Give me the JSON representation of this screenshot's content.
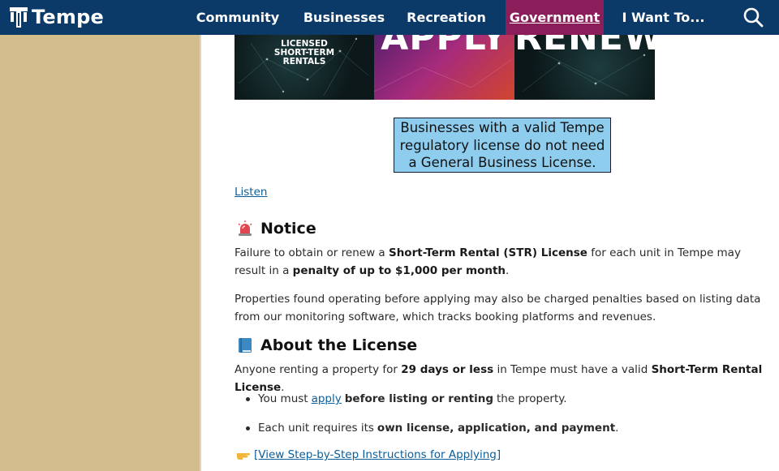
{
  "header": {
    "logo_text": "Tempe",
    "nav": [
      {
        "label": "Community"
      },
      {
        "label": "Businesses"
      },
      {
        "label": "Recreation"
      },
      {
        "label": "Government",
        "active": true
      },
      {
        "label": "I Want To..."
      }
    ],
    "search_icon": "search-icon",
    "colors": {
      "bar": "#0b3a68",
      "active_tab": "#8b1d5a"
    }
  },
  "sidebar": {
    "color": "#d4bd8c"
  },
  "hero": {
    "panel_1_text": "LICENSED\nSHORT-TERM\nRENTALS",
    "panel_2_text": "APPLY",
    "panel_3_text": "RENEW"
  },
  "callout": {
    "text": "Businesses with a valid Tempe regulatory license do not need a General Business License.",
    "color": "#8ecdee"
  },
  "listen_link": "Listen",
  "notice": {
    "icon": "rotating-light-icon",
    "title": "Notice",
    "p1": {
      "t1": "Failure to obtain or renew a ",
      "b1": "Short-Term Rental (STR) License",
      "t2": " for each unit in Tempe may result in a ",
      "b2": "penalty of up to $1,000 per month",
      "t3": "."
    },
    "p2": "Properties found operating before applying may also be charged penalties based on listing data from our monitoring software, which tracks booking platforms and revenues."
  },
  "about": {
    "icon": "blue-book-icon",
    "title": "About the License",
    "p1": {
      "t1": "Anyone renting a property for ",
      "b1": "29 days or less",
      "t2": " in Tempe must have a valid ",
      "b2": "Short-Term Rental License",
      "t3": "."
    },
    "bullet_1": {
      "t1": "You must ",
      "link": "apply",
      "b1": " before listing or renting",
      "t2": " the property."
    },
    "bullet_2": {
      "t1": "Each unit requires its ",
      "b1": "own license, application, and payment",
      "t2": "."
    },
    "instructions_icon": "pointing-hand-icon",
    "instructions_link": "[View Step-by-Step Instructions for Applying]"
  }
}
